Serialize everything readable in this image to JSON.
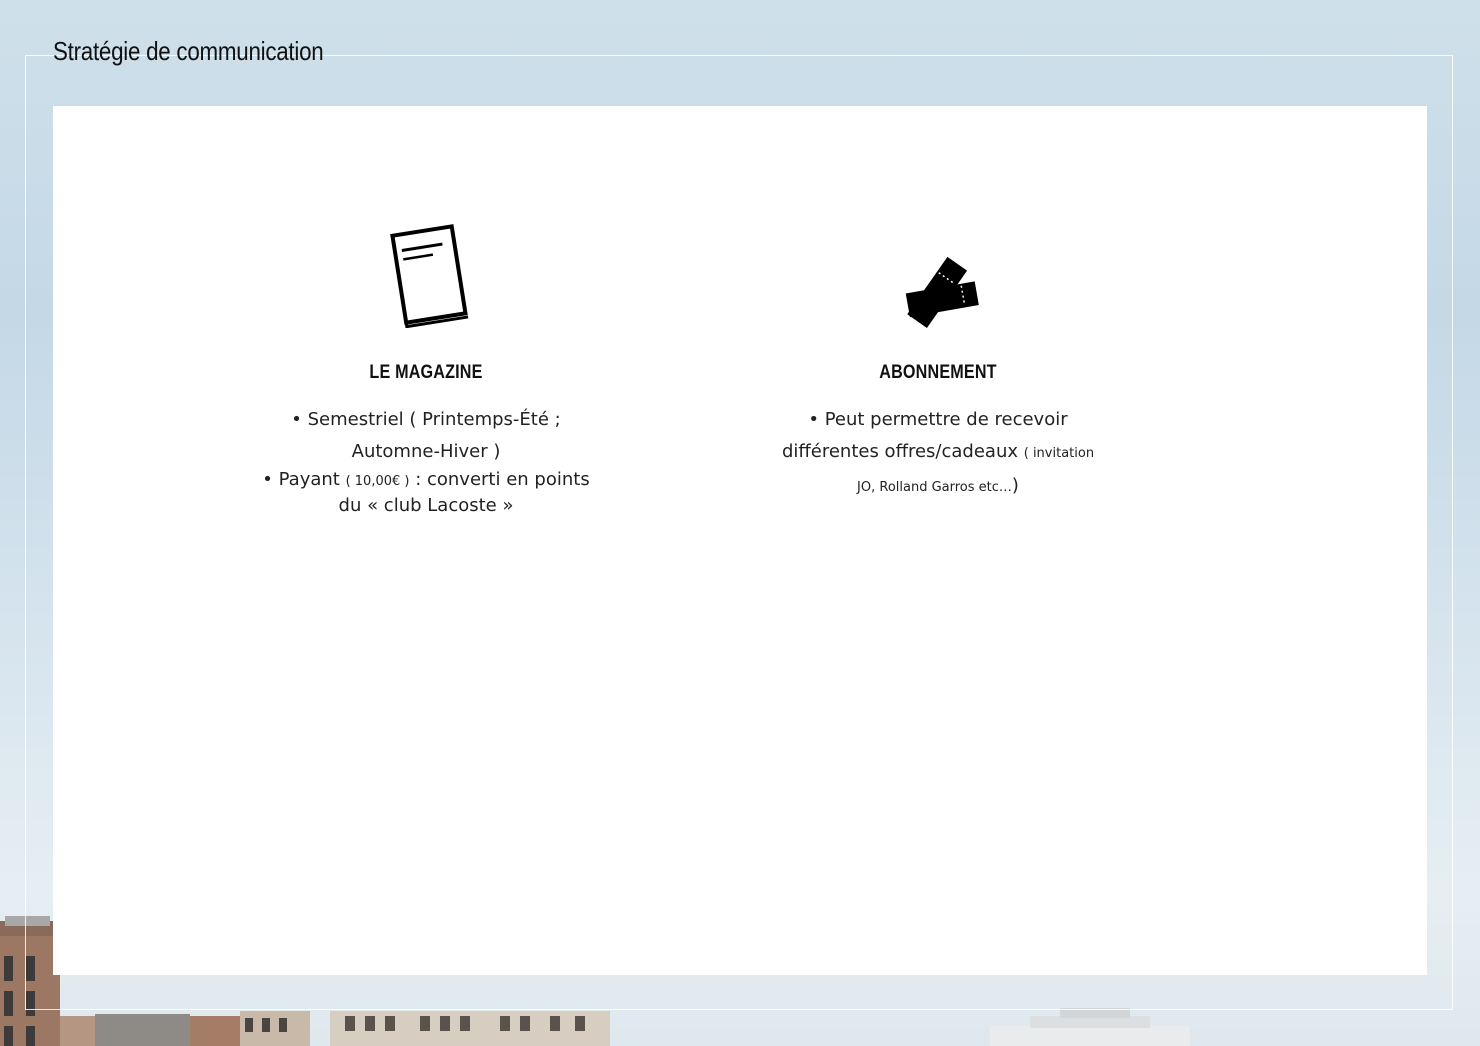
{
  "header": {
    "title": "Stratégie de communication"
  },
  "columns": [
    {
      "icon": "magazine-icon",
      "heading": "LE MAGAZINE",
      "line1": "• Semestriel ( Printemps-Été ;",
      "line2": "Automne-Hiver )",
      "line3_a": "• Payant ",
      "line3_small": "( 10,00€ )",
      "line3_b": " : converti en points",
      "line4": "du « club Lacoste »"
    },
    {
      "icon": "tickets-icon",
      "heading": "ABONNEMENT",
      "line1": "• Peut permettre de recevoir",
      "line2_a": "différentes offres/cadeaux ",
      "line2_small": "( invitation",
      "line3_small": "JO, Rolland Garros etc…",
      "line3_b": ")"
    }
  ],
  "colors": {
    "background_sky": "#cfe0ea",
    "card": "#ffffff",
    "text": "#111111"
  }
}
